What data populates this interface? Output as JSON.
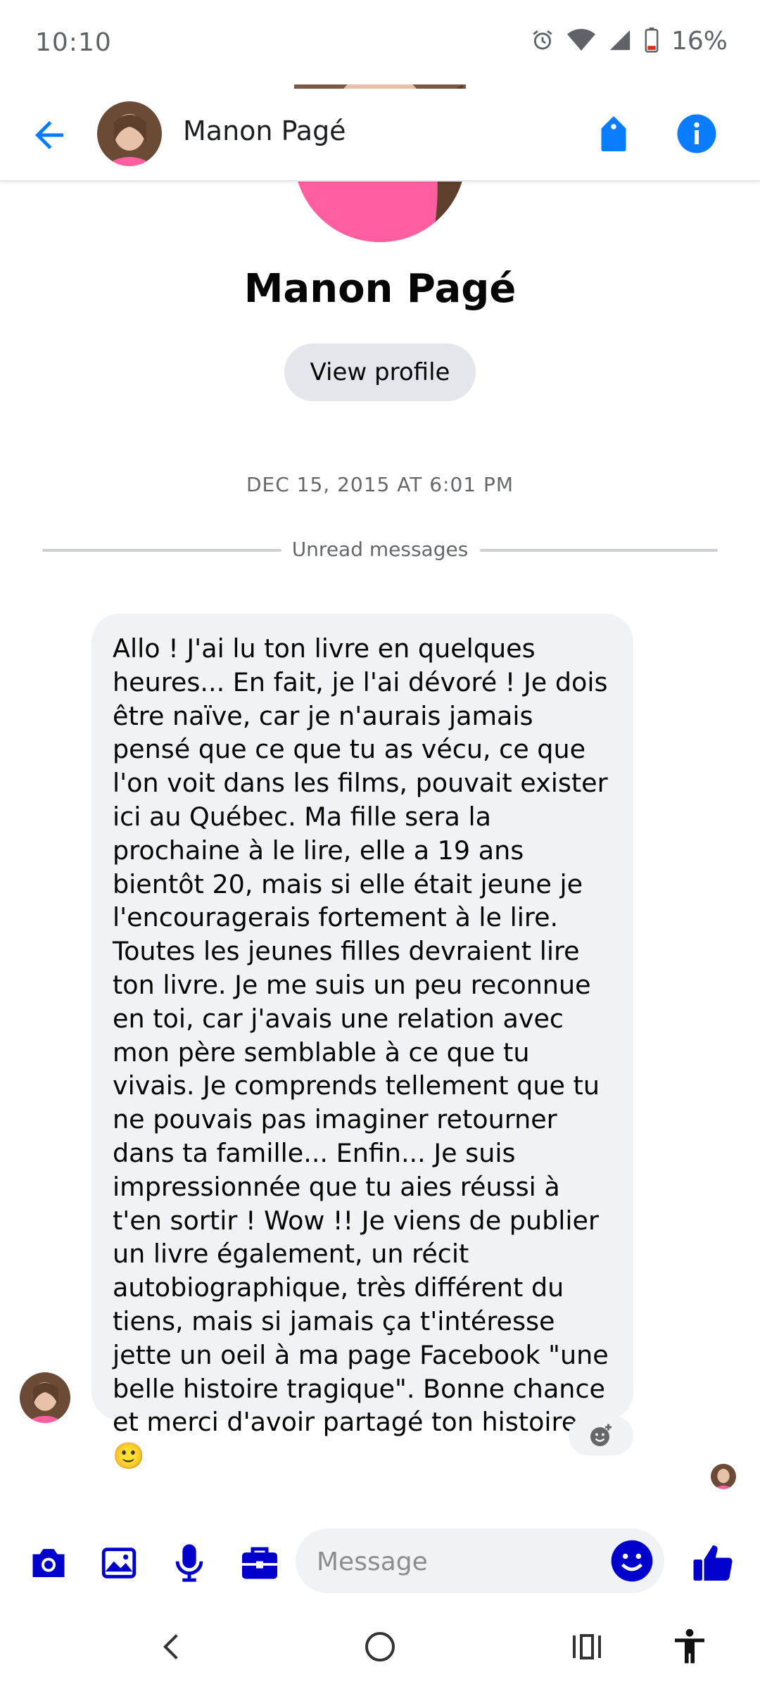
{
  "status_bar": {
    "time": "10:10",
    "battery": "16%"
  },
  "header": {
    "name": "Manon Pagé"
  },
  "intro": {
    "name": "Manon Pagé",
    "view_profile_label": "View profile",
    "timestamp": "DEC 15, 2015 AT 6:01 PM",
    "unread_label": "Unread messages"
  },
  "message": {
    "text": "Allo ! J'ai lu ton livre en quelques heures... En fait, je l'ai dévoré !  Je dois être naïve, car je n'aurais jamais pensé que ce que tu as vécu, ce que l'on voit dans les films, pouvait exister ici au Québec.  Ma fille sera la prochaine à le lire, elle a 19 ans bientôt 20, mais si elle était jeune je l'encouragerais fortement à le lire.  Toutes les jeunes filles devraient lire ton livre.  Je me suis un peu reconnue en toi, car j'avais une relation avec mon père semblable à ce que tu vivais.  Je comprends tellement que tu ne pouvais pas imaginer retourner dans ta famille... Enfin... Je suis impressionnée que tu aies réussi à t'en sortir ! Wow !!  Je viens de publier un livre également, un récit autobiographique, très différent du tiens, mais si jamais ça t'intéresse jette un oeil à ma page Facebook \"une belle histoire tragique\".  Bonne chance et merci d'avoir partagé ton histoire",
    "emoji": "🙂"
  },
  "composer": {
    "placeholder": "Message"
  },
  "colors": {
    "accent": "#0a7cff",
    "composer_blue": "#0000cc",
    "bubble": "#f0f2f5"
  },
  "icons": [
    "back-arrow-icon",
    "tag-icon",
    "info-icon",
    "camera-icon",
    "image-icon",
    "microphone-icon",
    "briefcase-icon",
    "smiley-icon",
    "thumbs-up-icon",
    "add-reaction-icon",
    "nav-back-icon",
    "nav-home-icon",
    "nav-recents-icon",
    "accessibility-icon",
    "alarm-icon",
    "wifi-icon",
    "signal-icon",
    "battery-icon"
  ]
}
